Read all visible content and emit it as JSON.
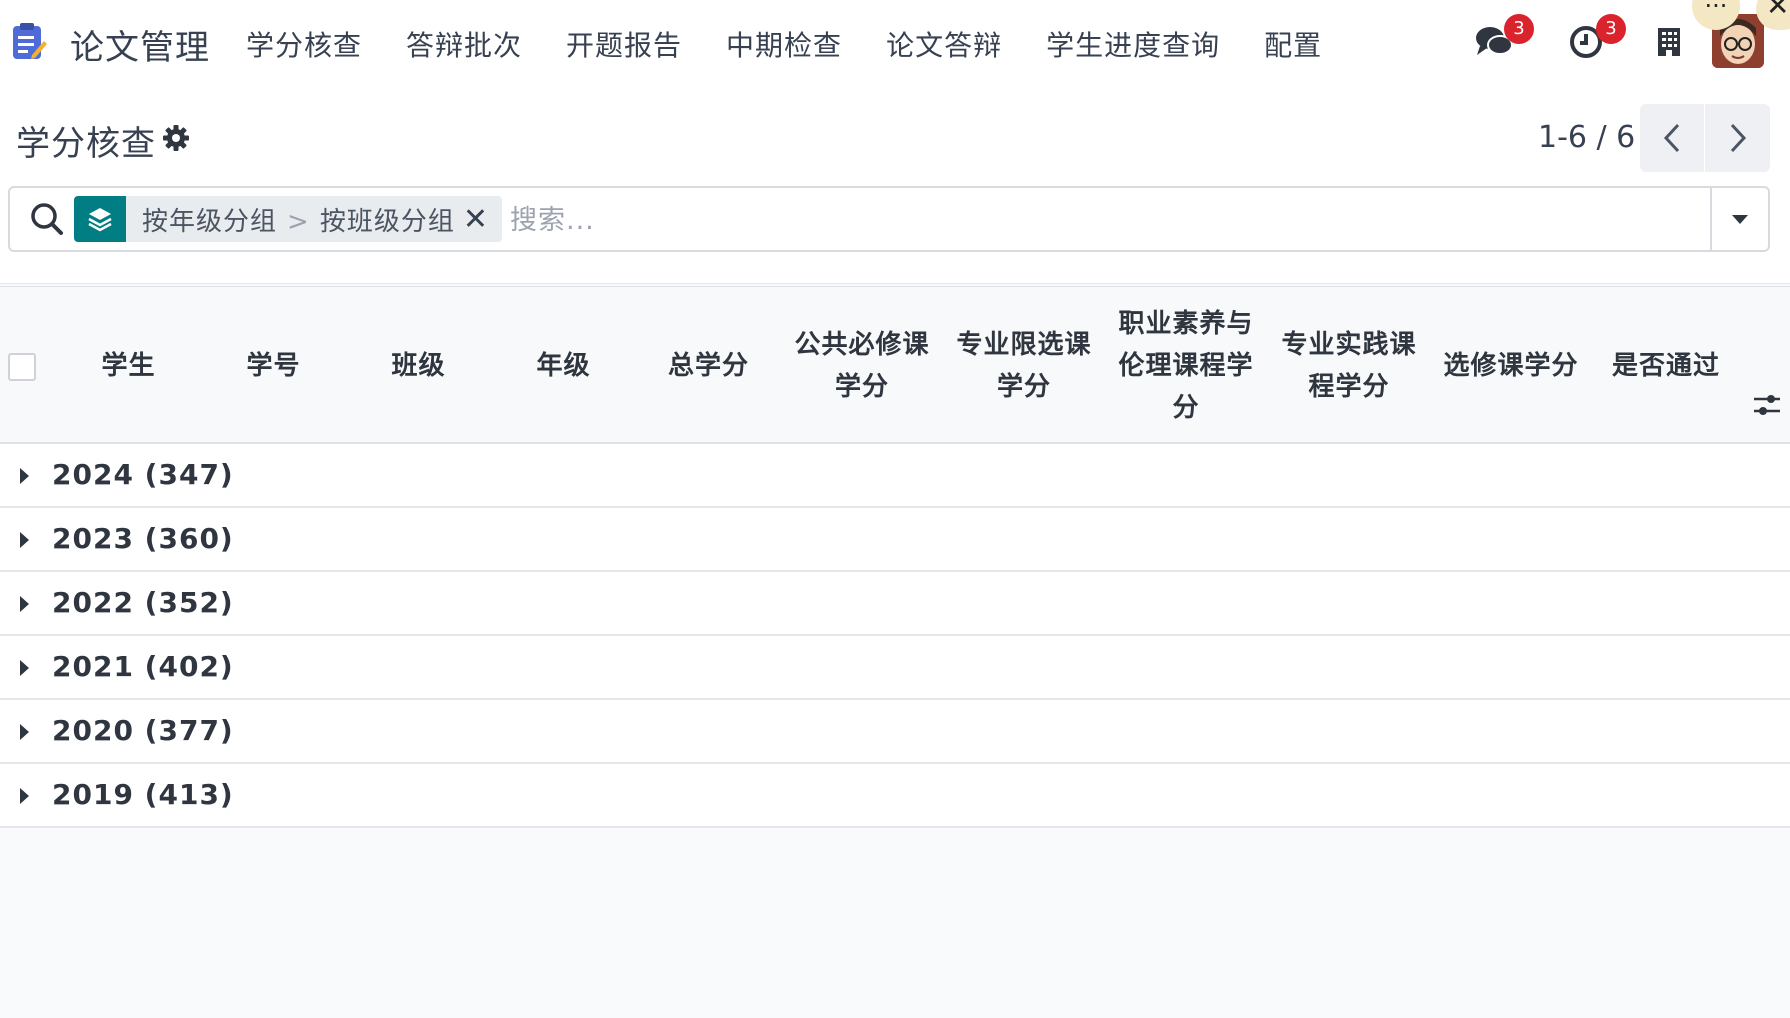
{
  "nav": {
    "app_name": "论文管理",
    "menu": [
      "学分核查",
      "答辩批次",
      "开题报告",
      "中期检查",
      "论文答辩",
      "学生进度查询",
      "配置"
    ],
    "messages_badge": "3",
    "activities_badge": "3",
    "corner_dots": "···",
    "corner_close": "✕"
  },
  "control": {
    "breadcrumb": "学分核查",
    "pager": "1-6 / 6"
  },
  "search": {
    "facet_parts": [
      "按年级分组",
      ">",
      "按班级分组"
    ],
    "facet_remove": "✕",
    "placeholder": "搜索..."
  },
  "table": {
    "columns": [
      "学生",
      "学号",
      "班级",
      "年级",
      "总学分",
      "公共必修课学分",
      "专业限选课学分",
      "职业素养与伦理课程学分",
      "专业实践课程学分",
      "选修课学分",
      "是否通过"
    ],
    "groups": [
      {
        "label": "2024 (347)"
      },
      {
        "label": "2023 (360)"
      },
      {
        "label": "2022 (352)"
      },
      {
        "label": "2021 (402)"
      },
      {
        "label": "2020 (377)"
      },
      {
        "label": "2019 (413)"
      }
    ]
  },
  "colors": {
    "accent": "#017e84",
    "badge": "#d9232d",
    "logo": "#4f6bd8"
  }
}
